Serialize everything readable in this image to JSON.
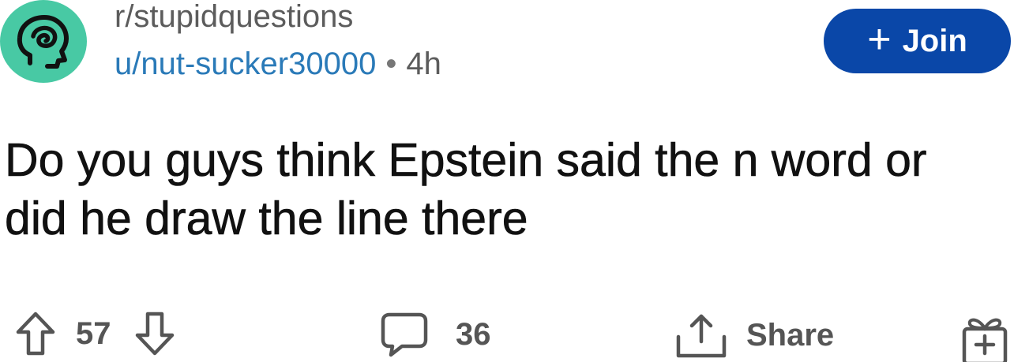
{
  "header": {
    "subreddit": "r/stupidquestions",
    "username": "u/nut-sucker30000",
    "separator": "•",
    "age": "4h",
    "join_label": "Join",
    "join_plus": "+"
  },
  "post": {
    "title": "Do you guys think Epstein said the n word or did he draw the line there"
  },
  "actions": {
    "score": "57",
    "comments": "36",
    "share_label": "Share"
  },
  "icons": {
    "avatar": "subreddit-head-icon",
    "upvote": "upvote-arrow-icon",
    "downvote": "downvote-arrow-icon",
    "comment": "comment-bubble-icon",
    "share": "share-icon",
    "award": "gift-icon"
  },
  "colors": {
    "avatar_bg": "#48c9a4",
    "join_bg": "#0a47a8",
    "username": "#2a7ab8"
  }
}
